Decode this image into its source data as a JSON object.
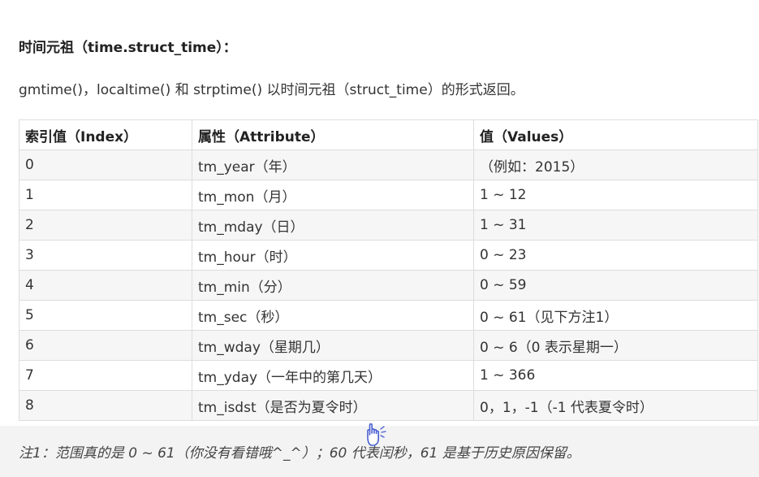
{
  "section": {
    "heading": "时间元祖（time.struct_time）：",
    "description": "gmtime()，localtime() 和 strptime() 以时间元祖（struct_time）的形式返回。"
  },
  "table": {
    "headers": [
      "索引值（Index）",
      "属性（Attribute）",
      "值（Values）"
    ],
    "rows": [
      [
        "0",
        "tm_year（年）",
        "（例如：2015）"
      ],
      [
        "1",
        "tm_mon（月）",
        "1 ~ 12"
      ],
      [
        "2",
        "tm_mday（日）",
        "1 ~ 31"
      ],
      [
        "3",
        "tm_hour（时）",
        "0 ~ 23"
      ],
      [
        "4",
        "tm_min（分）",
        "0 ~ 59"
      ],
      [
        "5",
        "tm_sec（秒）",
        "0 ~ 61（见下方注1）"
      ],
      [
        "6",
        "tm_wday（星期几）",
        "0 ~ 6（0 表示星期一）"
      ],
      [
        "7",
        "tm_yday（一年中的第几天）",
        "1 ~ 366"
      ],
      [
        "8",
        "tm_isdst（是否为夏令时）",
        "0，1，-1（-1 代表夏令时）"
      ]
    ]
  },
  "note": {
    "text": "注1：范围真的是 0 ~ 61（你没有看错哦^_^）；60 代表闰秒，61 是基于历史原因保留。"
  },
  "cursor": {
    "icon": "hand-pointer-icon"
  }
}
